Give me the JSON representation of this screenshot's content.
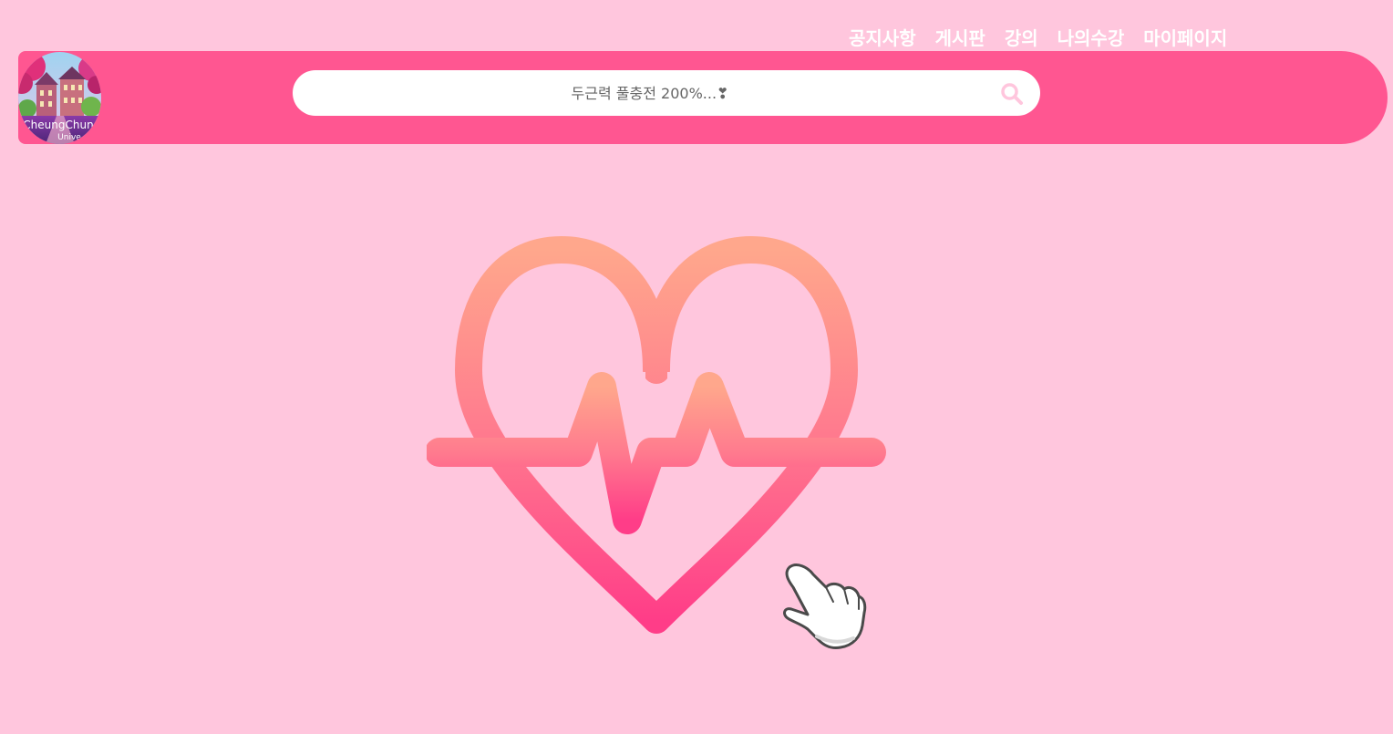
{
  "nav": {
    "items": [
      {
        "label": "공지사항"
      },
      {
        "label": "게시판"
      },
      {
        "label": "강의"
      },
      {
        "label": "나의수강"
      },
      {
        "label": "마이페이지"
      }
    ]
  },
  "logo": {
    "text_line1": "CheungChun",
    "text_line2": "Unive"
  },
  "search": {
    "placeholder": "두근력 풀충전 200%...❣",
    "icon": "search-icon"
  },
  "hero": {
    "icon": "heartbeat-icon",
    "pointer": "pointing-hand-icon"
  },
  "colors": {
    "background": "#ffc6dd",
    "header": "#ff5691",
    "heart_top": "#ffa78c",
    "heart_bottom": "#ff3d88",
    "search_icon": "#ffc6dd"
  }
}
